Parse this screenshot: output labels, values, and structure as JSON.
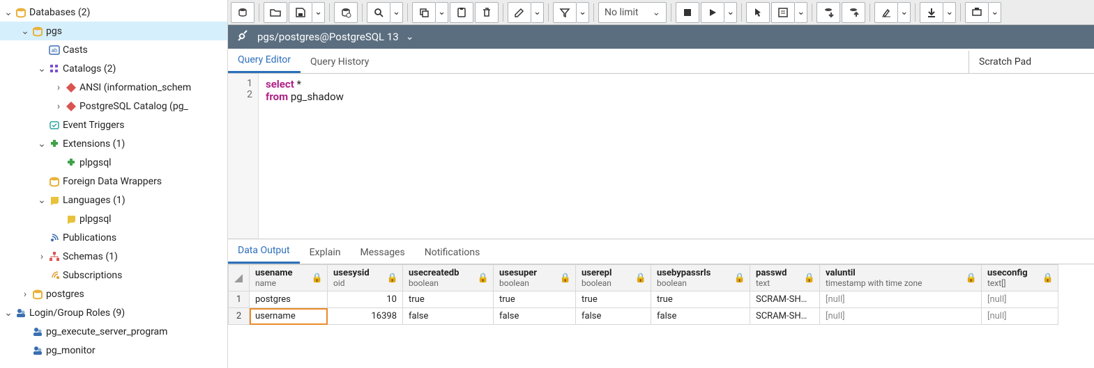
{
  "tree": {
    "databases": {
      "label": "Databases (2)",
      "expanded": true
    },
    "pgs": {
      "label": "pgs",
      "expanded": true,
      "selected": true
    },
    "casts": {
      "label": "Casts"
    },
    "catalogs": {
      "label": "Catalogs (2)",
      "expanded": true
    },
    "ansi": {
      "label": "ANSI (information_schem"
    },
    "pgcat": {
      "label": "PostgreSQL Catalog (pg_"
    },
    "evtrig": {
      "label": "Event Triggers"
    },
    "ext": {
      "label": "Extensions (1)",
      "expanded": true
    },
    "plpgsql_ext": {
      "label": "plpgsql"
    },
    "fdw": {
      "label": "Foreign Data Wrappers"
    },
    "langs": {
      "label": "Languages (1)",
      "expanded": true
    },
    "plpgsql_lang": {
      "label": "plpgsql"
    },
    "pubs": {
      "label": "Publications"
    },
    "schemas": {
      "label": "Schemas (1)"
    },
    "subs": {
      "label": "Subscriptions"
    },
    "postgres_db": {
      "label": "postgres"
    },
    "roles": {
      "label": "Login/Group Roles (9)",
      "expanded": true
    },
    "role1": {
      "label": "pg_execute_server_program"
    },
    "role2": {
      "label": "pg_monitor"
    }
  },
  "toolbar": {
    "nolimit": "No limit"
  },
  "connection": {
    "label": "pgs/postgres@PostgreSQL 13"
  },
  "tabs": {
    "editor": "Query Editor",
    "history": "Query History",
    "scratch": "Scratch Pad"
  },
  "sql": {
    "line1_kw": "select",
    "line1_rest": " *",
    "line2_kw": "from",
    "line2_rest": " pg_shadow"
  },
  "gutters": [
    "1",
    "2"
  ],
  "out_tabs": {
    "data": "Data Output",
    "explain": "Explain",
    "messages": "Messages",
    "notifications": "Notifications"
  },
  "columns": [
    {
      "name": "usename",
      "type": "name"
    },
    {
      "name": "usesysid",
      "type": "oid"
    },
    {
      "name": "usecreatedb",
      "type": "boolean"
    },
    {
      "name": "usesuper",
      "type": "boolean"
    },
    {
      "name": "userepl",
      "type": "boolean"
    },
    {
      "name": "usebypassrls",
      "type": "boolean"
    },
    {
      "name": "passwd",
      "type": "text"
    },
    {
      "name": "valuntil",
      "type": "timestamp with time zone"
    },
    {
      "name": "useconfig",
      "type": "text[]"
    }
  ],
  "rows": [
    {
      "n": "1",
      "usename": "postgres",
      "usesysid": "10",
      "usecreatedb": "true",
      "usesuper": "true",
      "userepl": "true",
      "usebypassrls": "true",
      "passwd": "SCRAM-SH…",
      "valuntil": "[null]",
      "useconfig": "[null]"
    },
    {
      "n": "2",
      "usename": "username",
      "usesysid": "16398",
      "usecreatedb": "false",
      "usesuper": "false",
      "userepl": "false",
      "usebypassrls": "false",
      "passwd": "SCRAM-SH…",
      "valuntil": "[null]",
      "useconfig": "[null]"
    }
  ],
  "highlight": {
    "row": 1,
    "col": "usename"
  }
}
